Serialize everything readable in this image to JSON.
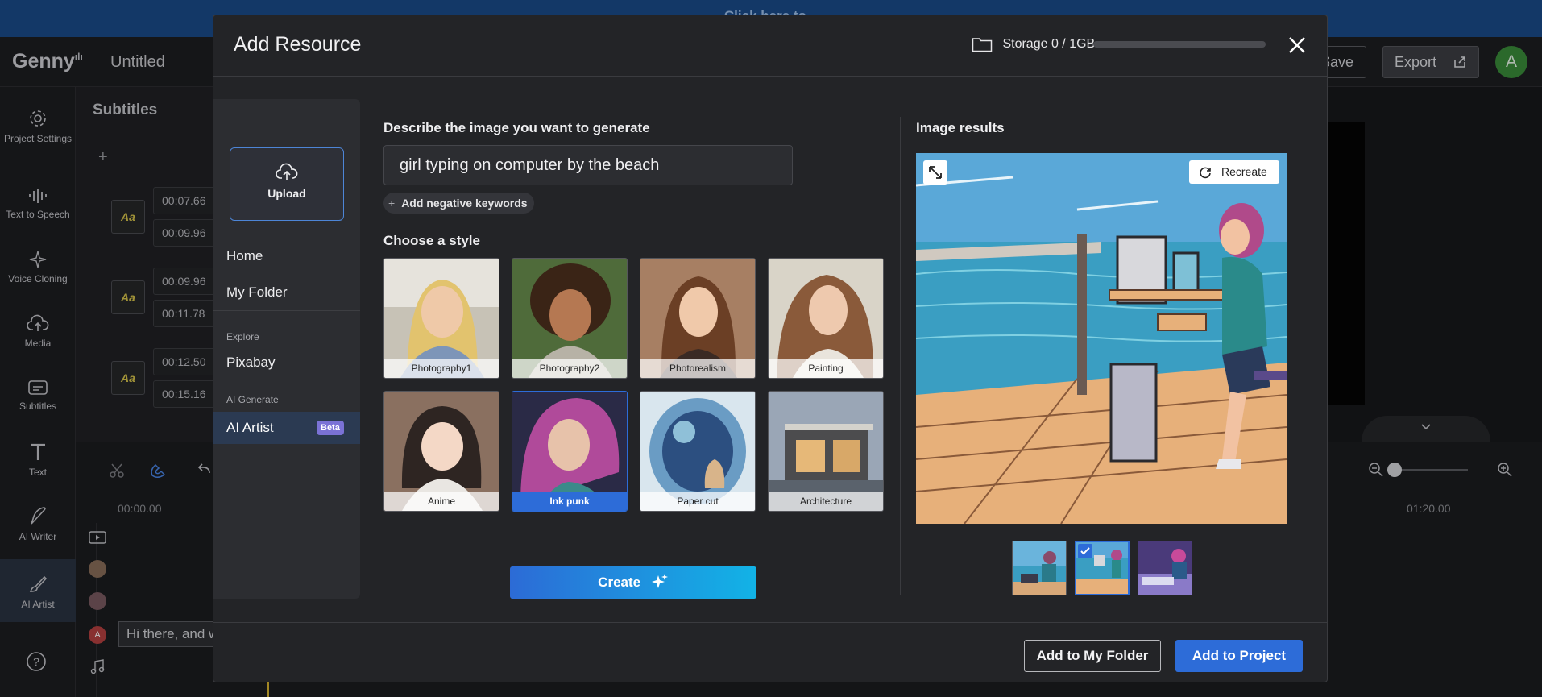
{
  "app": {
    "banner_text": "Click here to...",
    "logo": "Genny",
    "doc_title": "Untitled",
    "save_label": "Save",
    "export_label": "Export",
    "avatar_letter": "A"
  },
  "leftbar": {
    "items": [
      {
        "label": "Project Settings",
        "icon": "gear-icon"
      },
      {
        "label": "Text to Speech",
        "icon": "waveform-icon"
      },
      {
        "label": "Voice Cloning",
        "icon": "sparkle-icon"
      },
      {
        "label": "Media",
        "icon": "cloud-upload-icon"
      },
      {
        "label": "Subtitles",
        "icon": "subtitles-icon"
      },
      {
        "label": "Text",
        "icon": "text-t-icon"
      },
      {
        "label": "AI Writer",
        "icon": "feather-icon"
      },
      {
        "label": "AI Artist",
        "icon": "brush-icon"
      }
    ]
  },
  "subtitles_panel": {
    "title": "Subtitles",
    "rows": [
      {
        "start": "00:07.66",
        "end": "00:09.96"
      },
      {
        "start": "00:09.96",
        "end": "00:11.78"
      },
      {
        "start": "00:12.50",
        "end": "00:15.16"
      }
    ],
    "style_badge": "Aa"
  },
  "timeline": {
    "ruler_start": "00:00.00",
    "ruler_end": "01:20.00",
    "text_track_value": "Hi there, and w",
    "avatar_letter": "A"
  },
  "modal": {
    "title": "Add Resource",
    "storage_label": "Storage",
    "storage_value": "0 / 1GB",
    "storage_used_fraction": 0,
    "sidebar": {
      "upload_label": "Upload",
      "home": "Home",
      "my_folder": "My Folder",
      "explore_section": "Explore",
      "pixabay": "Pixabay",
      "ai_section": "AI Generate",
      "ai_artist": "AI Artist",
      "beta_badge": "Beta"
    },
    "describe_label": "Describe the image you want to generate",
    "prompt_value": "girl typing on computer by the beach",
    "negative_keywords_label": "Add negative keywords",
    "style_label": "Choose a style",
    "styles": [
      {
        "name": "Photography1",
        "selected": false
      },
      {
        "name": "Photography2",
        "selected": false
      },
      {
        "name": "Photorealism",
        "selected": false
      },
      {
        "name": "Painting",
        "selected": false
      },
      {
        "name": "Anime",
        "selected": false
      },
      {
        "name": "Ink punk",
        "selected": true
      },
      {
        "name": "Paper cut",
        "selected": false
      },
      {
        "name": "Architecture",
        "selected": false
      }
    ],
    "create_label": "Create",
    "results_label": "Image results",
    "recreate_label": "Recreate",
    "result_thumbs": [
      {
        "selected": false
      },
      {
        "selected": true
      },
      {
        "selected": false
      }
    ],
    "add_folder_label": "Add to My Folder",
    "add_project_label": "Add to Project"
  },
  "colors": {
    "accent": "#2d6cd8",
    "beta": "#7a72d6",
    "modal_bg": "#232427"
  }
}
